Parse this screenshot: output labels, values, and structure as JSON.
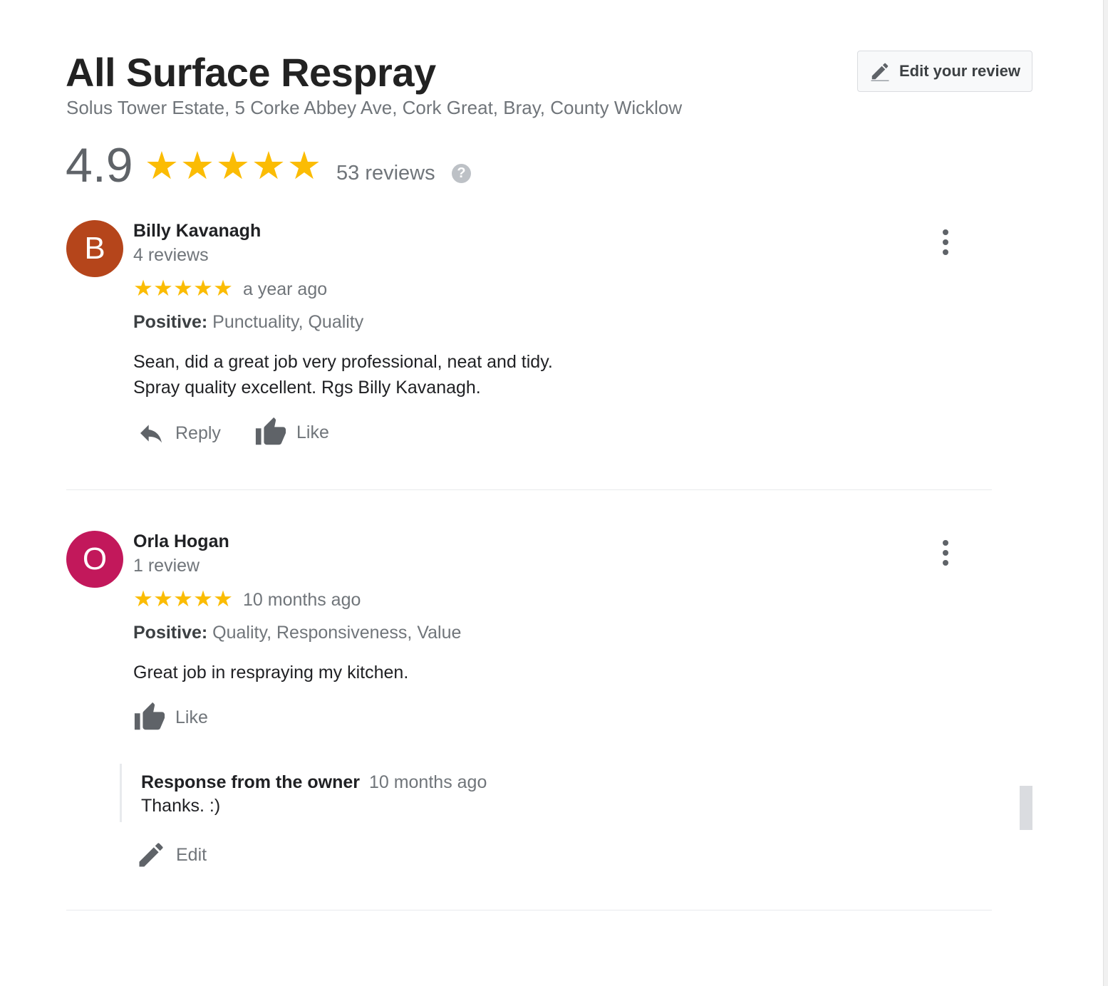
{
  "business": {
    "name": "All Surface Respray",
    "address": "Solus Tower Estate, 5 Corke Abbey Ave, Cork Great, Bray, County Wicklow",
    "edit_review_label": "Edit your review",
    "rating": "4.9",
    "stars": 5,
    "total_reviews": "53 reviews",
    "help_glyph": "?"
  },
  "reviews": [
    {
      "avatar_letter": "B",
      "avatar_color": "#b5451b",
      "name": "Billy Kavanagh",
      "review_count": "4 reviews",
      "stars": 5,
      "date": "a year ago",
      "positive_label": "Positive:",
      "positive_values": "Punctuality, Quality",
      "text_line1": "Sean, did a great job very professional, neat and tidy.",
      "text_line2": "Spray quality excellent. Rgs Billy Kavanagh.",
      "reply_label": "Reply",
      "like_label": "Like"
    },
    {
      "avatar_letter": "O",
      "avatar_color": "#c2185b",
      "name": "Orla Hogan",
      "review_count": "1 review",
      "stars": 5,
      "date": "10 months ago",
      "positive_label": "Positive:",
      "positive_values": "Quality, Responsiveness, Value",
      "text_line1": "Great job in respraying my kitchen.",
      "like_label": "Like",
      "owner_response": {
        "label": "Response from the owner",
        "date": "10 months ago",
        "text": "Thanks. :)"
      },
      "edit_label": "Edit"
    }
  ],
  "icons": {
    "edit_review": "pencil-icon",
    "help": "help-circle-icon",
    "more": "more-vert-icon",
    "reply": "reply-arrow-icon",
    "like": "thumb-up-icon",
    "edit": "pencil-icon"
  },
  "colors": {
    "star": "#fbbc04",
    "secondary_text": "#70757a",
    "primary_text": "#202124"
  }
}
